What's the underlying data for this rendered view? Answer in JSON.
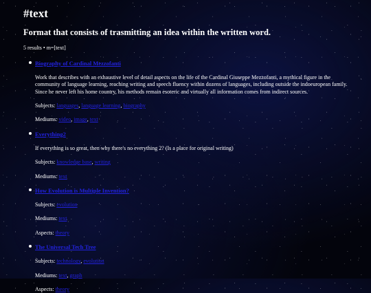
{
  "page": {
    "title": "#text",
    "subtitle": "Format that consists of trasmitting an idea within the written word.",
    "meta": "5 results • m=[text]"
  },
  "entries": [
    {
      "title": "Biography of Cardinal Mezzofanti",
      "description": "Work that describes with an exhaustive level of detail aspects on the life of the Cardinal Giuseppe Mezzofanti, a mythical figure in the community of language learning, reaching writing and speech fluency within dozens of languages, including outside the indoeuropean family. Since he never left his home country, his methods remain esoteric and virtually all information comes from indirect sources.",
      "subjects_label": "Subjects:",
      "subjects": [
        "languages",
        "language learning",
        "biography"
      ],
      "mediums_label": "Mediums:",
      "mediums": [
        "video",
        "image",
        "text"
      ]
    },
    {
      "title": "Everything2",
      "description": "If everything is so great, then why there's no everything 2? (Is a place for original writing)",
      "subjects_label": "Subjects:",
      "subjects": [
        "knowledge base",
        "writing"
      ],
      "mediums_label": "Mediums:",
      "mediums": [
        "text"
      ]
    },
    {
      "title": "How Evolution is Multiple Invention?",
      "subjects_label": "Subjects:",
      "subjects": [
        "evolution"
      ],
      "mediums_label": "Mediums:",
      "mediums": [
        "text"
      ],
      "aspects_label": "Aspects:",
      "aspects": [
        "theory"
      ]
    },
    {
      "title": "The Universal Tech Tree",
      "subjects_label": "Subjects:",
      "subjects": [
        "technology",
        "evolution"
      ],
      "mediums_label": "Mediums:",
      "mediums": [
        "text",
        "graph"
      ],
      "aspects_label": "Aspects:",
      "aspects": [
        "theory"
      ]
    }
  ]
}
